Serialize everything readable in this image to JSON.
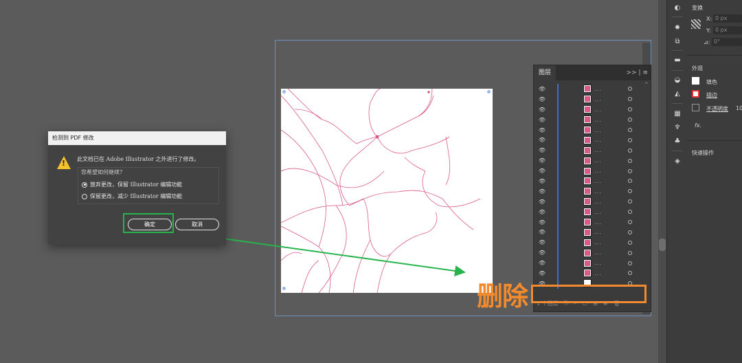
{
  "dialog": {
    "title": "检测到 PDF 修改",
    "message": "此文档已在 Adobe Illustrator 之外进行了修改。",
    "question": "您希望如何继续？",
    "option1": "放弃更改，保留 Illustrator 编辑功能",
    "option2": "保留更改，减少 Illustrator 编辑功能",
    "selected": "option1",
    "ok_label": "确定",
    "cancel_label": "取消"
  },
  "layers_panel": {
    "tab_label": "图层",
    "menu_label": ">> | ≡",
    "row_count": 20,
    "bottom_bar": "1 个图层"
  },
  "annotation": {
    "delete_label": "删除",
    "highlight_color": "#f28a2e",
    "arrow_color": "#28b44c"
  },
  "properties": {
    "section_transform": "变换",
    "x_label": "X:",
    "x_value": "0 px",
    "y_label": "Y:",
    "y_value": "0 px",
    "angle_label": "⊿:",
    "angle_value": "0°",
    "section_appearance": "外观",
    "fill_label": "填色",
    "stroke_label": "描边",
    "opacity_label": "不透明度",
    "opacity_value": "10",
    "fx_label": "fx.",
    "section_quick": "快速操作"
  },
  "colors": {
    "map_line": "#d95a86",
    "artboard_border": "#6f8fbf",
    "layer_bar": "#3d6fd6"
  }
}
